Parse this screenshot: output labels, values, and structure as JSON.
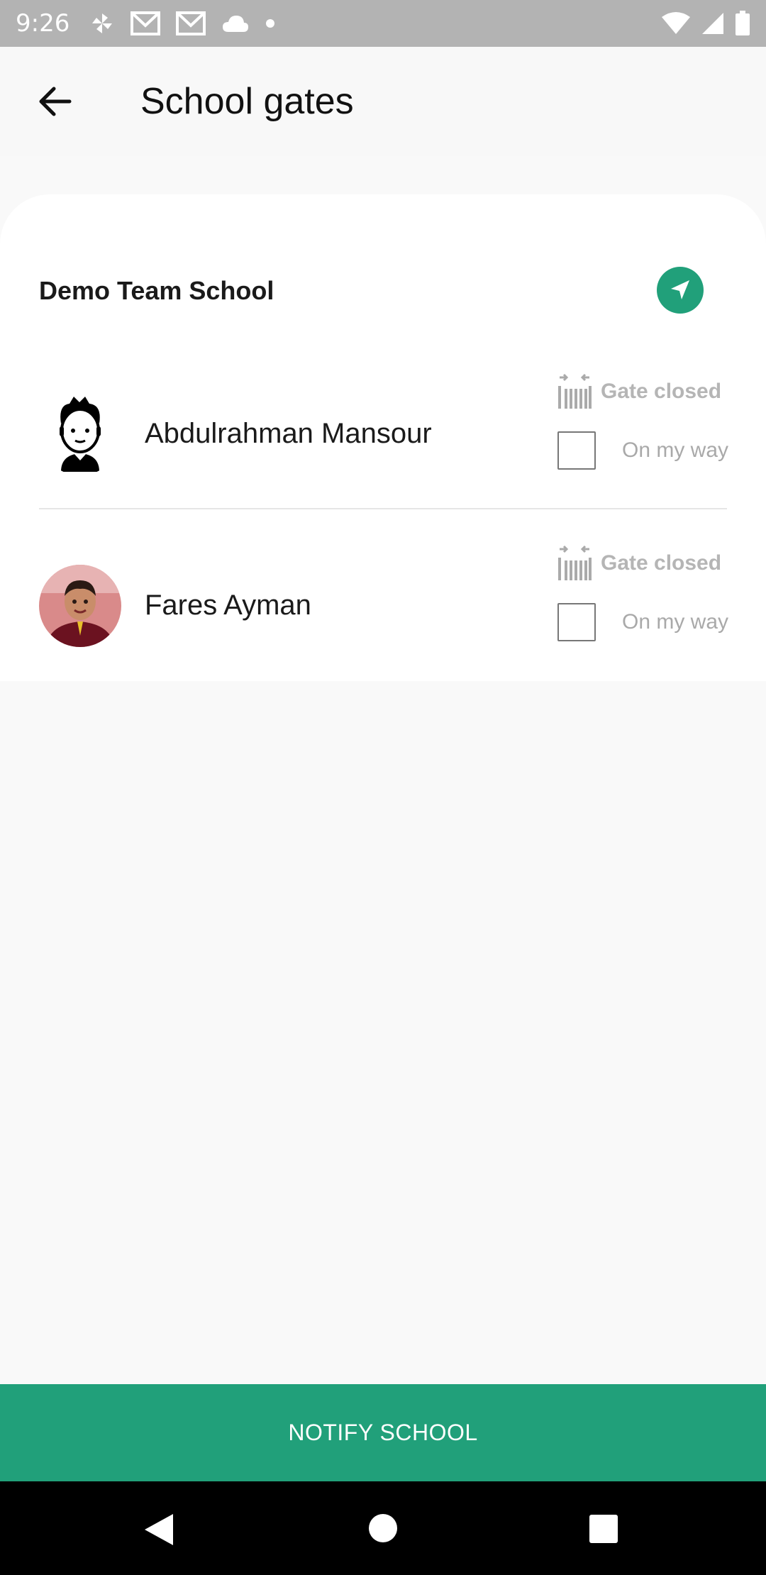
{
  "status_bar": {
    "time": "9:26",
    "left_icons": [
      "pinwheel-icon",
      "gmail-icon",
      "gmail-icon",
      "cloud-icon",
      "dot-icon"
    ],
    "right_icons": [
      "wifi-icon",
      "signal-icon",
      "battery-icon"
    ]
  },
  "app_bar": {
    "title": "School gates",
    "back_icon": "arrow-left-icon"
  },
  "school": {
    "name": "Demo Team School",
    "locate_icon": "navigation-icon"
  },
  "students": [
    {
      "name": "Abdulrahman Mansour",
      "avatar": "cartoon-boy-avatar",
      "gate_status": "Gate closed",
      "on_my_way_label": "On my way",
      "on_my_way_checked": false
    },
    {
      "name": "Fares Ayman",
      "avatar": "photo-avatar",
      "gate_status": "Gate closed",
      "on_my_way_label": "On my way",
      "on_my_way_checked": false
    }
  ],
  "notify_button": {
    "label": "NOTIFY SCHOOL"
  },
  "colors": {
    "accent": "#21a07a",
    "status_bar": "#b3b3b3",
    "muted_text": "#b5b5b5"
  }
}
